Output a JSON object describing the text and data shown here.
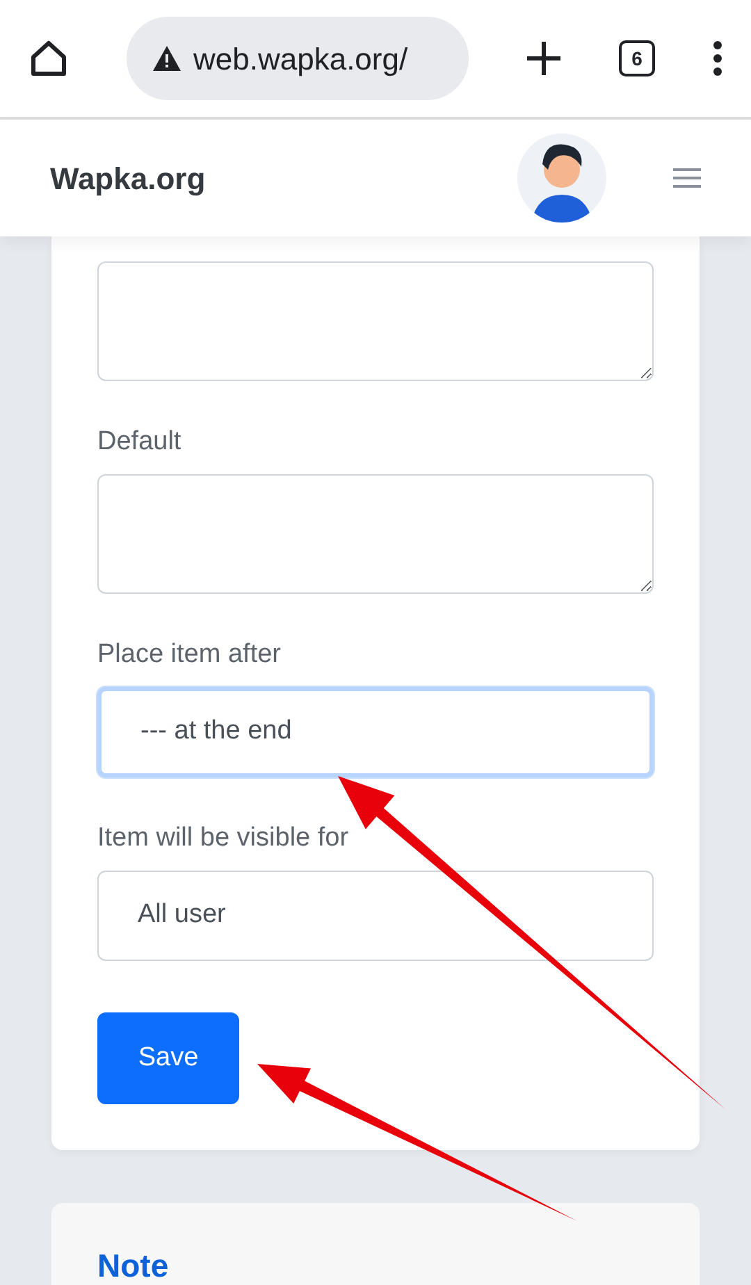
{
  "browser": {
    "url": "web.wapka.org/",
    "tab_count": "6"
  },
  "header": {
    "brand": "Wapka.org"
  },
  "form": {
    "fields": [
      {
        "kind": "textarea"
      },
      {
        "kind": "textarea",
        "label": "Default"
      },
      {
        "kind": "select",
        "label": "Place item after",
        "value": "--- at the end",
        "focused": true
      },
      {
        "kind": "select",
        "label": "Item will be visible for",
        "value": "All user",
        "focused": false
      }
    ],
    "submit": "Save"
  },
  "note": {
    "title": "Note"
  }
}
